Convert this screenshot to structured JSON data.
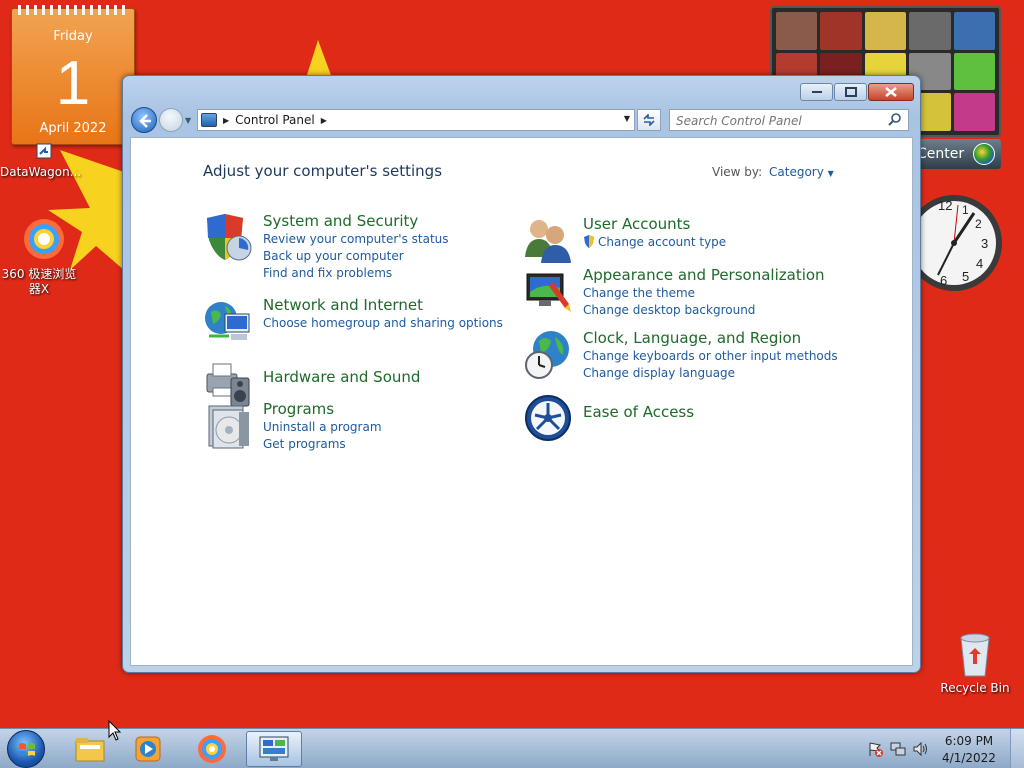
{
  "desktop": {
    "calendar_gadget": {
      "day_name": "Friday",
      "day_number": "1",
      "month_year": "April 2022"
    },
    "media_gadget": {
      "label": "Center"
    },
    "icons": [
      {
        "label": "DataWagon..."
      },
      {
        "label": "360 极速浏览器X"
      },
      {
        "label": "Recycle Bin"
      }
    ]
  },
  "window": {
    "address": {
      "crumb": "Control Panel"
    },
    "search": {
      "placeholder": "Search Control Panel"
    },
    "heading": "Adjust your computer's settings",
    "view_by": {
      "label": "View by:",
      "value": "Category"
    },
    "categories_left": [
      {
        "title": "System and Security",
        "icon": "security-shield-icon",
        "links": [
          "Review your computer's status",
          "Back up your computer",
          "Find and fix problems"
        ]
      },
      {
        "title": "Network and Internet",
        "icon": "network-globe-icon",
        "links": [
          "Choose homegroup and sharing options"
        ]
      },
      {
        "title": "Hardware and Sound",
        "icon": "printer-speaker-icon",
        "links": []
      },
      {
        "title": "Programs",
        "icon": "programs-disc-icon",
        "links": [
          "Uninstall a program",
          "Get programs"
        ]
      }
    ],
    "categories_right": [
      {
        "title": "User Accounts",
        "icon": "users-icon",
        "links": [
          "Change account type"
        ]
      },
      {
        "title": "Appearance and Personalization",
        "icon": "monitor-paint-icon",
        "links": [
          "Change the theme",
          "Change desktop background"
        ]
      },
      {
        "title": "Clock, Language, and Region",
        "icon": "globe-clock-icon",
        "links": [
          "Change keyboards or other input methods",
          "Change display language"
        ]
      },
      {
        "title": "Ease of Access",
        "icon": "ease-of-access-icon",
        "links": []
      }
    ]
  },
  "taskbar": {
    "time": "6:09 PM",
    "date": "4/1/2022"
  },
  "colors": {
    "desktop_bg": "#e02a18",
    "category_title": "#1e6a2a",
    "link": "#1e5a9e"
  }
}
